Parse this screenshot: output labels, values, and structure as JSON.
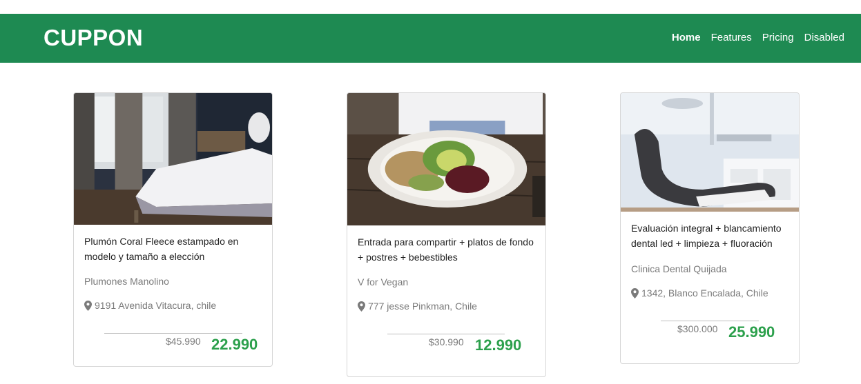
{
  "header": {
    "brand": "CUPPON",
    "nav": [
      "Home",
      "Features",
      "Pricing",
      "Disabled"
    ]
  },
  "colors": {
    "navbar": "#1e8a52",
    "price": "#2ca04c",
    "muted": "#7a7a7a"
  },
  "cards": [
    {
      "image": "bedroom-photo",
      "title": "Plumón Coral Fleece estampado en modelo y tamaño a elección",
      "company": "Plumones Manolino",
      "address": "9191 Avenida Vitacura, chile",
      "old_price": "$45.990",
      "new_price": "22.990"
    },
    {
      "image": "salad-plate-photo",
      "title": "Entrada para compartir + platos de fondo + postres + bebestibles",
      "company": "V for Vegan",
      "address": "777 jesse Pinkman, Chile",
      "old_price": "$30.990",
      "new_price": "12.990"
    },
    {
      "image": "dental-clinic-photo",
      "title": "Evaluación integral + blancamiento dental led + limpieza + fluoración",
      "company": "Clinica Dental Quijada",
      "address": "1342, Blanco Encalada, Chile",
      "old_price": "$300.000",
      "new_price": "25.990"
    }
  ]
}
